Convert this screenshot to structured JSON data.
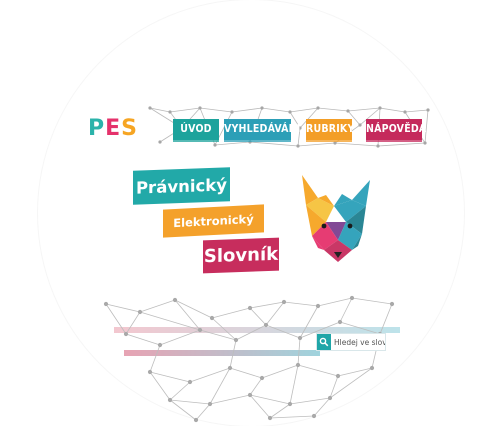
{
  "brand": {
    "logo_text": "PES",
    "logo_letters": [
      "P",
      "E",
      "S"
    ],
    "logo_colors": [
      "#2bb3aa",
      "#e5326b",
      "#f6a523"
    ]
  },
  "nav": {
    "items": [
      {
        "label": "ÚVOD",
        "color": "#1da39c"
      },
      {
        "label": "VYHLEDÁVÁNÍ",
        "color": "#2c9fb7"
      },
      {
        "label": "RUBRIKY",
        "color": "#f39e27"
      },
      {
        "label": "NÁPOVĚDA",
        "color": "#c52a5c"
      }
    ]
  },
  "hero": {
    "line1": "Právnický",
    "line2": "Elektronický",
    "line3": "Slovník",
    "colors": {
      "line1": "#22a9a8",
      "line2": "#f4a12b",
      "line3": "#c72d5d"
    }
  },
  "search": {
    "placeholder": "Hledej ve slovníku",
    "button_icon": "search-icon"
  },
  "mascot": {
    "icon": "fox-head-icon",
    "palette": [
      "#2a9fb8",
      "#1f7f8f",
      "#f6a422",
      "#e5326b",
      "#7b3f8f",
      "#c62c5e",
      "#f5c23b"
    ]
  }
}
